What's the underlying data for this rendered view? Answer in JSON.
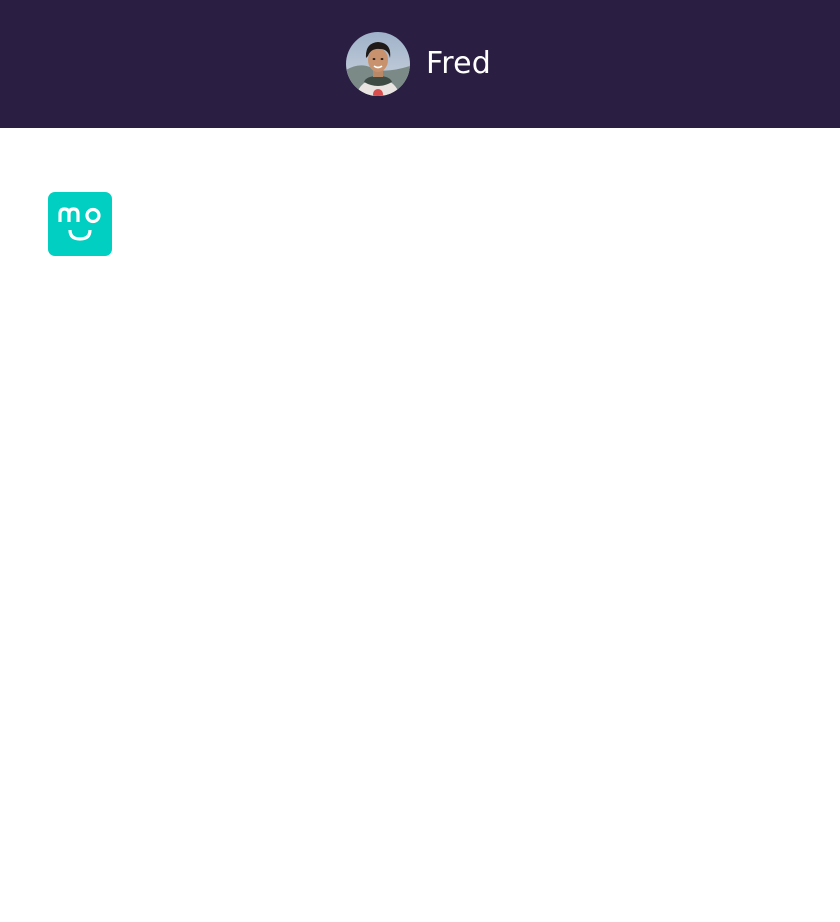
{
  "header": {
    "background_color": "#2a1e42",
    "user": {
      "name": "Fred",
      "avatar_icon": "user-photo-avatar"
    }
  },
  "main": {
    "app_logo": {
      "icon": "mo-smiley-logo",
      "background_color": "#00cfc1",
      "wordmark": "mo"
    }
  }
}
